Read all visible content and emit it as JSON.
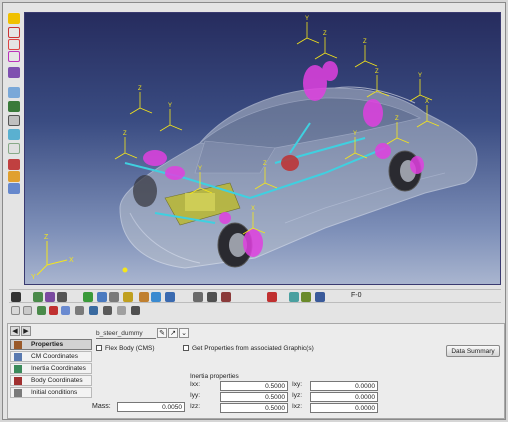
{
  "viewport": {
    "axis_labels": {
      "x": "X",
      "y": "Y",
      "z": "Z"
    },
    "triad_labels": [
      "Z",
      "Y",
      "Z",
      "Y",
      "Z",
      "Y",
      "X",
      "Z",
      "Y",
      "Z",
      "X",
      "Y",
      "Z",
      "Z"
    ]
  },
  "horizontal_toolbar": {
    "icons": [
      "triad-icon",
      "sphere-icon",
      "joint-icon",
      "cursor-icon",
      "check-icon",
      "grid-icon",
      "frame-icon",
      "color-ball-icon",
      "spring-icon",
      "axis-icon",
      "mesh-icon",
      "measure-icon",
      "rotate-icon",
      "graph-icon",
      "arrow-right-icon",
      "solver-icon",
      "layers-icon",
      "chart-icon"
    ],
    "readout": "F-0"
  },
  "panel": {
    "entity_name": "b_steer_dummy",
    "tabs": [
      {
        "label": "Properties",
        "active": true
      },
      {
        "label": "CM Coordinates",
        "active": false
      },
      {
        "label": "Inertia Coordinates",
        "active": false
      },
      {
        "label": "Body Coordinates",
        "active": false
      },
      {
        "label": "Initial conditions",
        "active": false
      }
    ],
    "flex_body_label": "Flex Body (CMS)",
    "graphics_label": "Get Properties from associated Graphic(s)",
    "summary_button": "Data Summary",
    "inertia_title": "Inertia properties",
    "mass_label": "Mass:",
    "mass_value": "0.0050",
    "inertia": [
      {
        "label": "Ixx:",
        "value": "0.5000",
        "label2": "Ixy:",
        "value2": "0.0000"
      },
      {
        "label": "Iyy:",
        "value": "0.5000",
        "label2": "Iyz:",
        "value2": "0.0000"
      },
      {
        "label": "Izz:",
        "value": "0.5000",
        "label2": "Ixz:",
        "value2": "0.0000"
      }
    ]
  },
  "colors": {
    "viewport_top": "#262c5e",
    "viewport_bottom": "#a9b5cf",
    "body_magenta": "#e040e0",
    "triad_yellow": "#f5e61a",
    "cyan_link": "#3fd0e0"
  }
}
